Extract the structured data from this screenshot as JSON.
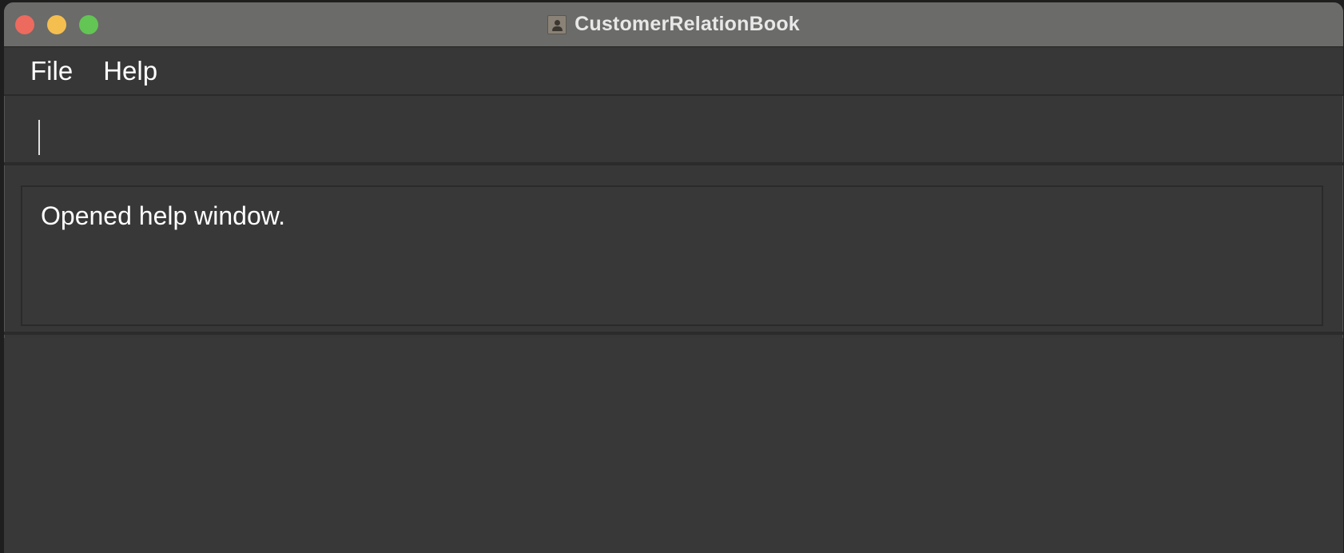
{
  "window": {
    "title": "CustomerRelationBook",
    "app_icon": "contact-book-icon"
  },
  "menubar": {
    "items": [
      "File",
      "Help"
    ]
  },
  "command_box": {
    "value": "",
    "placeholder": ""
  },
  "result_display": {
    "text": "Opened help window."
  },
  "colors": {
    "close": "#ed6a5e",
    "minimize": "#f5bf4f",
    "maximize": "#62c554",
    "background": "#373737",
    "titlebar": "#6b6b69"
  }
}
